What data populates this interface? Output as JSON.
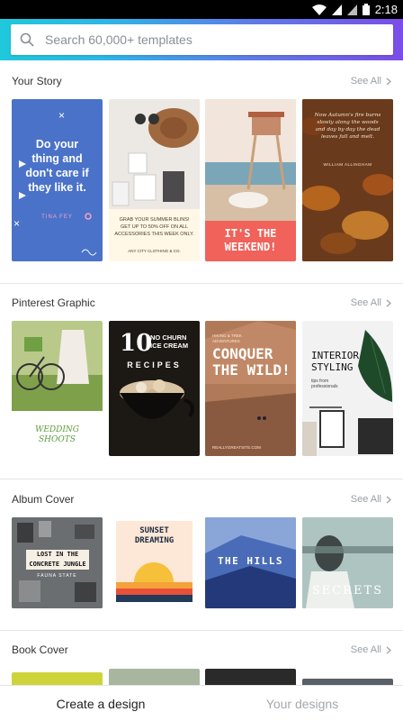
{
  "status_bar": {
    "time": "2:18"
  },
  "search": {
    "placeholder": "Search 60,000+ templates"
  },
  "sections": [
    {
      "title": "Your Story",
      "see_all": "See All",
      "tiles": [
        {
          "text": "Do your thing and don't care if they like it.",
          "sub": "TINA FEY"
        },
        {
          "text": "GRAB YOUR SUMMER BLINS! GET UP TO 50% OFF ON ALL ACCESSORIES THIS WEEK ONLY.",
          "sub": "ANY CITY CLOTHING & CO."
        },
        {
          "text": "IT'S THE WEEKEND!"
        },
        {
          "text": "Now Autumn's fire burns slowly along the woods and day by day the dead leaves fall and melt.",
          "sub": "WILLIAM ALLINGHAM"
        }
      ]
    },
    {
      "title": "Pinterest Graphic",
      "see_all": "See All",
      "tiles": [
        {
          "text": "WEDDING SHOOTS"
        },
        {
          "num": "10",
          "text": "NO CHURN ICE CREAM",
          "sub": "RECIPES"
        },
        {
          "text": "CONQUER THE WILD!",
          "kicker": "HIKING & TREK ADVENTURES",
          "sub": "REALLYGREATSITE.COM"
        },
        {
          "text": "INTERIOR STYLING",
          "sub": "tips from professionals"
        }
      ]
    },
    {
      "title": "Album Cover",
      "see_all": "See All",
      "tiles": [
        {
          "text": "LOST IN THE CONCRETE JUNGLE",
          "sub": "FAUNA STATE"
        },
        {
          "text": "SUNSET DREAMING"
        },
        {
          "text": "THE HILLS"
        },
        {
          "text": "SECRETS"
        }
      ]
    },
    {
      "title": "Book Cover",
      "see_all": "See All"
    }
  ],
  "bottom_nav": {
    "create": "Create a design",
    "your_designs": "Your designs"
  }
}
